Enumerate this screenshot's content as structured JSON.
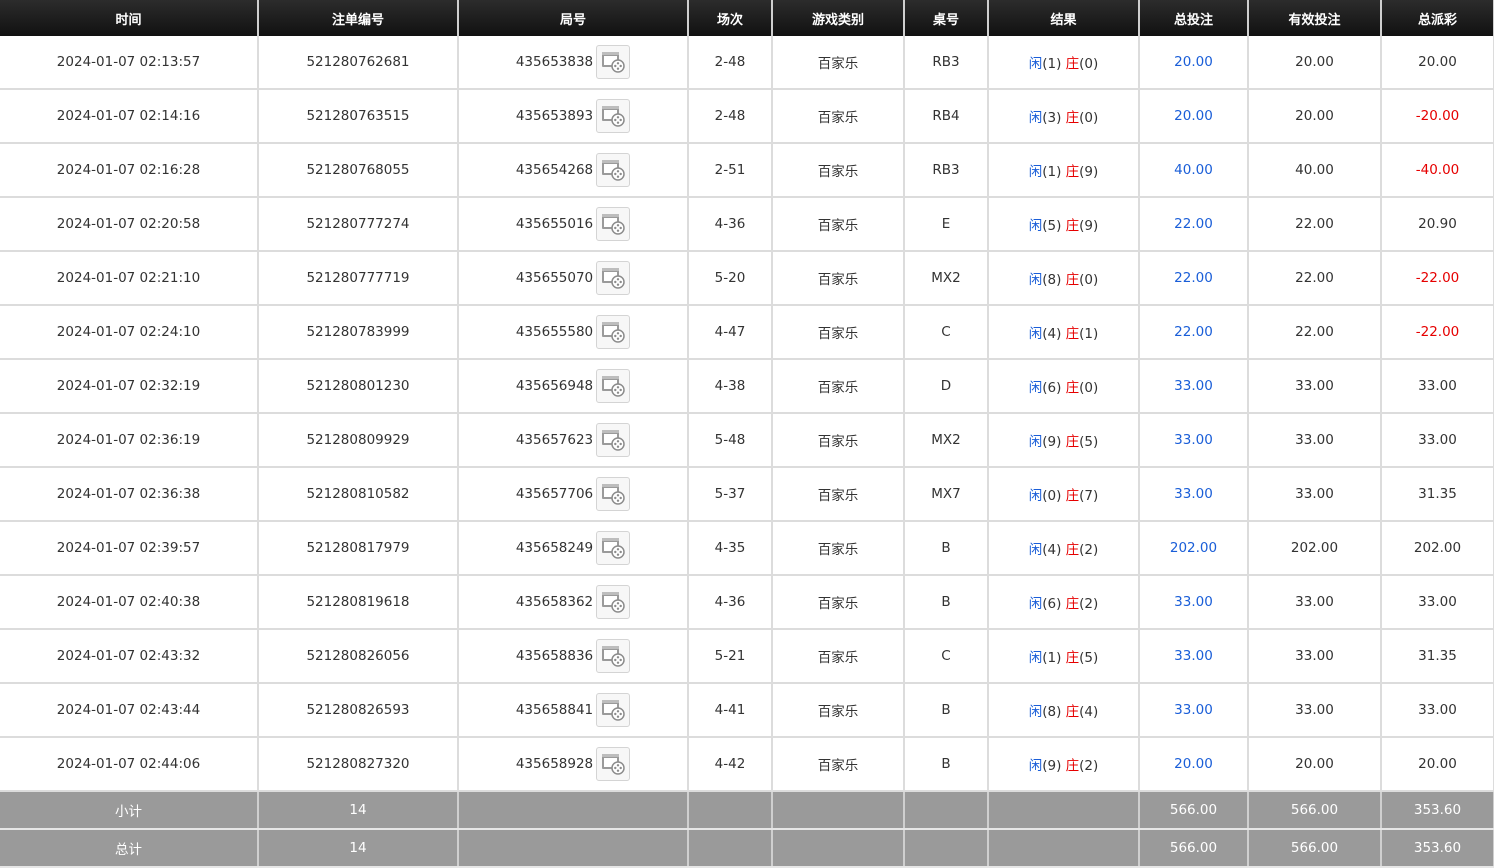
{
  "headers": [
    "时间",
    "注单编号",
    "局号",
    "场次",
    "游戏类别",
    "桌号",
    "结果",
    "总投注",
    "有效投注",
    "总派彩"
  ],
  "result_labels": {
    "player": "闲",
    "banker": "庄"
  },
  "rows": [
    {
      "time": "2024-01-07 02:13:57",
      "bet_id": "521280762681",
      "round_id": "435653838",
      "shoe": "2-48",
      "game": "百家乐",
      "table": "RB3",
      "player": "(1)",
      "banker": "(0)",
      "total_bet": "20.00",
      "valid_bet": "20.00",
      "payout": "20.00",
      "payout_negative": false
    },
    {
      "time": "2024-01-07 02:14:16",
      "bet_id": "521280763515",
      "round_id": "435653893",
      "shoe": "2-48",
      "game": "百家乐",
      "table": "RB4",
      "player": "(3)",
      "banker": "(0)",
      "total_bet": "20.00",
      "valid_bet": "20.00",
      "payout": "-20.00",
      "payout_negative": true
    },
    {
      "time": "2024-01-07 02:16:28",
      "bet_id": "521280768055",
      "round_id": "435654268",
      "shoe": "2-51",
      "game": "百家乐",
      "table": "RB3",
      "player": "(1)",
      "banker": "(9)",
      "total_bet": "40.00",
      "valid_bet": "40.00",
      "payout": "-40.00",
      "payout_negative": true
    },
    {
      "time": "2024-01-07 02:20:58",
      "bet_id": "521280777274",
      "round_id": "435655016",
      "shoe": "4-36",
      "game": "百家乐",
      "table": "E",
      "player": "(5)",
      "banker": "(9)",
      "total_bet": "22.00",
      "valid_bet": "22.00",
      "payout": "20.90",
      "payout_negative": false
    },
    {
      "time": "2024-01-07 02:21:10",
      "bet_id": "521280777719",
      "round_id": "435655070",
      "shoe": "5-20",
      "game": "百家乐",
      "table": "MX2",
      "player": "(8)",
      "banker": "(0)",
      "total_bet": "22.00",
      "valid_bet": "22.00",
      "payout": "-22.00",
      "payout_negative": true
    },
    {
      "time": "2024-01-07 02:24:10",
      "bet_id": "521280783999",
      "round_id": "435655580",
      "shoe": "4-47",
      "game": "百家乐",
      "table": "C",
      "player": "(4)",
      "banker": "(1)",
      "total_bet": "22.00",
      "valid_bet": "22.00",
      "payout": "-22.00",
      "payout_negative": true
    },
    {
      "time": "2024-01-07 02:32:19",
      "bet_id": "521280801230",
      "round_id": "435656948",
      "shoe": "4-38",
      "game": "百家乐",
      "table": "D",
      "player": "(6)",
      "banker": "(0)",
      "total_bet": "33.00",
      "valid_bet": "33.00",
      "payout": "33.00",
      "payout_negative": false
    },
    {
      "time": "2024-01-07 02:36:19",
      "bet_id": "521280809929",
      "round_id": "435657623",
      "shoe": "5-48",
      "game": "百家乐",
      "table": "MX2",
      "player": "(9)",
      "banker": "(5)",
      "total_bet": "33.00",
      "valid_bet": "33.00",
      "payout": "33.00",
      "payout_negative": false
    },
    {
      "time": "2024-01-07 02:36:38",
      "bet_id": "521280810582",
      "round_id": "435657706",
      "shoe": "5-37",
      "game": "百家乐",
      "table": "MX7",
      "player": "(0)",
      "banker": "(7)",
      "total_bet": "33.00",
      "valid_bet": "33.00",
      "payout": "31.35",
      "payout_negative": false
    },
    {
      "time": "2024-01-07 02:39:57",
      "bet_id": "521280817979",
      "round_id": "435658249",
      "shoe": "4-35",
      "game": "百家乐",
      "table": "B",
      "player": "(4)",
      "banker": "(2)",
      "total_bet": "202.00",
      "valid_bet": "202.00",
      "payout": "202.00",
      "payout_negative": false
    },
    {
      "time": "2024-01-07 02:40:38",
      "bet_id": "521280819618",
      "round_id": "435658362",
      "shoe": "4-36",
      "game": "百家乐",
      "table": "B",
      "player": "(6)",
      "banker": "(2)",
      "total_bet": "33.00",
      "valid_bet": "33.00",
      "payout": "33.00",
      "payout_negative": false
    },
    {
      "time": "2024-01-07 02:43:32",
      "bet_id": "521280826056",
      "round_id": "435658836",
      "shoe": "5-21",
      "game": "百家乐",
      "table": "C",
      "player": "(1)",
      "banker": "(5)",
      "total_bet": "33.00",
      "valid_bet": "33.00",
      "payout": "31.35",
      "payout_negative": false
    },
    {
      "time": "2024-01-07 02:43:44",
      "bet_id": "521280826593",
      "round_id": "435658841",
      "shoe": "4-41",
      "game": "百家乐",
      "table": "B",
      "player": "(8)",
      "banker": "(4)",
      "total_bet": "33.00",
      "valid_bet": "33.00",
      "payout": "33.00",
      "payout_negative": false
    },
    {
      "time": "2024-01-07 02:44:06",
      "bet_id": "521280827320",
      "round_id": "435658928",
      "shoe": "4-42",
      "game": "百家乐",
      "table": "B",
      "player": "(9)",
      "banker": "(2)",
      "total_bet": "20.00",
      "valid_bet": "20.00",
      "payout": "20.00",
      "payout_negative": false
    }
  ],
  "subtotal": {
    "label": "小计",
    "count": "14",
    "total_bet": "566.00",
    "valid_bet": "566.00",
    "payout": "353.60"
  },
  "grand_total": {
    "label": "总计",
    "count": "14",
    "total_bet": "566.00",
    "valid_bet": "566.00",
    "payout": "353.60"
  },
  "colors": {
    "header_bg": "#1b1b1b",
    "link_blue": "#1a5ed8",
    "negative_red": "#e60000",
    "footer_bg": "#9a9a9a"
  },
  "icons": {
    "video": "video-replay-icon"
  }
}
